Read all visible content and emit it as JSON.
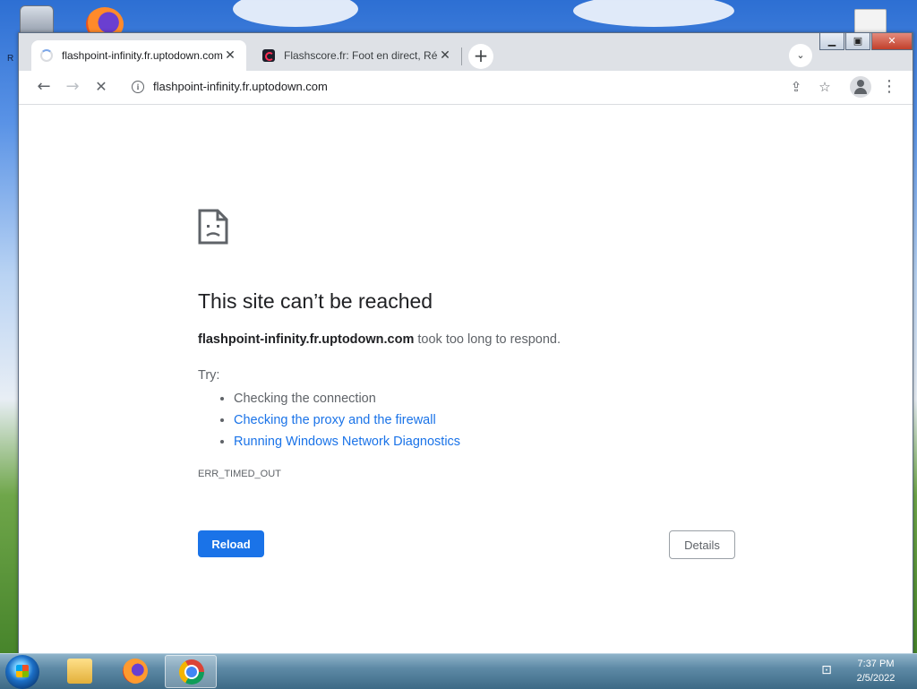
{
  "desktop": {
    "partial_label": "R"
  },
  "browser": {
    "tabs": [
      {
        "title": "flashpoint-infinity.fr.uptodown.com",
        "state": "loading",
        "close": "✕"
      },
      {
        "title": "Flashscore.fr: Foot en direct, Résultats",
        "state": "inactive",
        "close": "✕"
      }
    ],
    "new_tab_symbol": "+",
    "tab_search_symbol": "⌄",
    "window_controls": {
      "minimize": "▁",
      "maximize": "▣",
      "close": "✕"
    },
    "nav": {
      "back": "←",
      "forward": "→",
      "stop": "✕"
    },
    "address_bar": {
      "url": "flashpoint-infinity.fr.uptodown.com",
      "info_symbol": "i"
    },
    "toolbar_icons": {
      "share": "⇪",
      "bookmark": "☆",
      "menu": "⋮"
    }
  },
  "error_page": {
    "heading": "This site can’t be reached",
    "host": "flashpoint-infinity.fr.uptodown.com",
    "message_suffix": " took too long to respond.",
    "try_label": "Try:",
    "suggestions": [
      {
        "text": "Checking the connection",
        "link": false
      },
      {
        "text": "Checking the proxy and the firewall",
        "link": true
      },
      {
        "text": "Running Windows Network Diagnostics",
        "link": true
      }
    ],
    "error_code": "ERR_TIMED_OUT",
    "reload_label": "Reload",
    "details_label": "Details"
  },
  "taskbar": {
    "apps": [
      "file-explorer",
      "firefox",
      "chrome"
    ],
    "clock": {
      "time": "7:37 PM",
      "date": "2/5/2022"
    }
  },
  "colors": {
    "accent": "#1a73e8",
    "tabstrip": "#dee1e6",
    "link": "#1a73e8",
    "text_secondary": "#5f6368"
  }
}
